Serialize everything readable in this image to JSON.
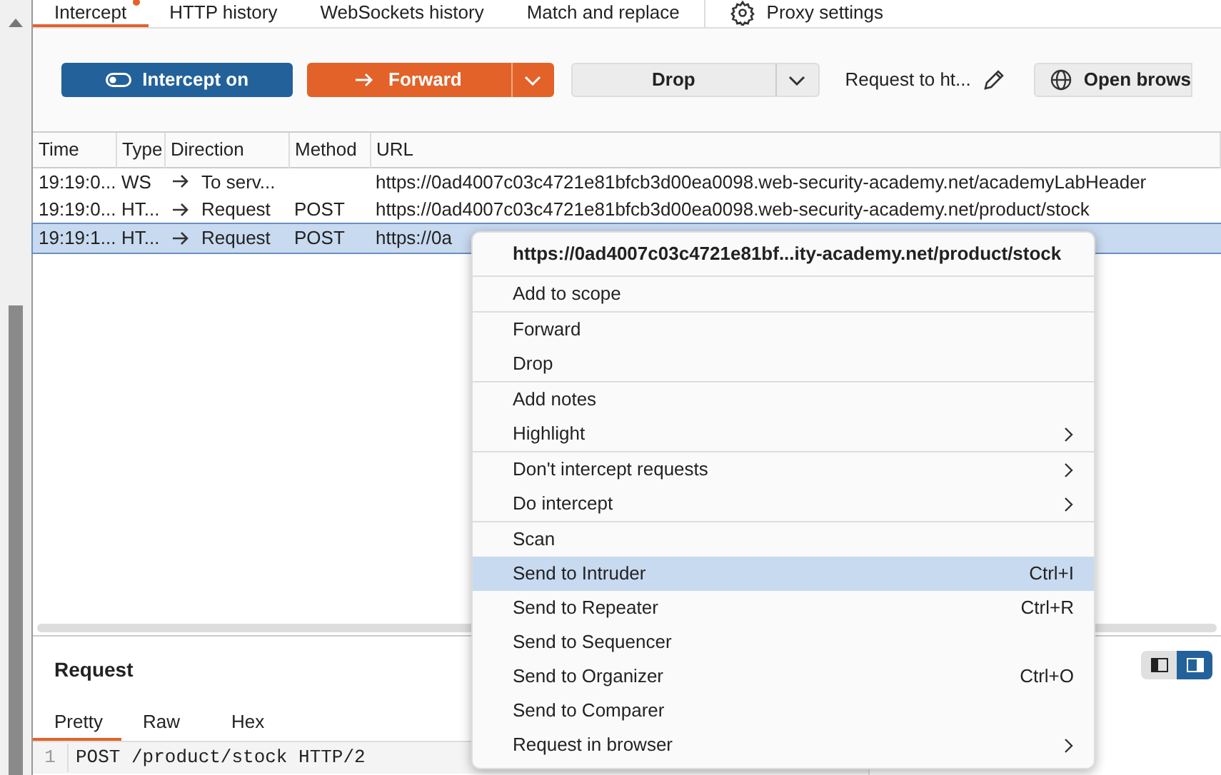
{
  "tabs": [
    {
      "label": "Intercept",
      "selected": true,
      "notification": true
    },
    {
      "label": "HTTP history",
      "selected": false,
      "notification": false
    },
    {
      "label": "WebSockets history",
      "selected": false,
      "notification": false
    },
    {
      "label": "Match and replace",
      "selected": false,
      "notification": false
    }
  ],
  "settings_tab": {
    "label": "Proxy settings"
  },
  "toolbar": {
    "intercept_button": {
      "label": "Intercept on",
      "on": true
    },
    "forward_button": {
      "label": "Forward"
    },
    "drop_button": {
      "label": "Drop"
    },
    "request_label": "Request to ht...",
    "open_browser_button": {
      "label": "Open brows"
    }
  },
  "table": {
    "columns": [
      "Time",
      "Type",
      "Direction",
      "Method",
      "URL"
    ],
    "rows": [
      {
        "time": "19:19:0...",
        "type": "WS",
        "direction": "To serv...",
        "url": "https://0ad4007c03c4721e81bfcb3d00ea0098.web-security-academy.net/academyLabHeader",
        "selected": false
      },
      {
        "time": "19:19:0...",
        "type": "HT...",
        "direction": "Request",
        "method": "POST",
        "url": "https://0ad4007c03c4721e81bfcb3d00ea0098.web-security-academy.net/product/stock",
        "selected": false
      },
      {
        "time": "19:19:1...",
        "type": "HT...",
        "direction": "Request",
        "method": "POST",
        "url": "https://0a",
        "selected": true
      }
    ]
  },
  "request_panel": {
    "title": "Request",
    "tabs": [
      {
        "label": "Pretty",
        "selected": true
      },
      {
        "label": "Raw",
        "selected": false
      },
      {
        "label": "Hex",
        "selected": false
      }
    ],
    "lines": [
      {
        "number": "1",
        "text": "POST /product/stock HTTP/2"
      }
    ],
    "layout_toggle": [
      {
        "selected": false
      },
      {
        "selected": true
      }
    ]
  },
  "context_menu": {
    "title": "https://0ad4007c03c4721e81bf...ity-academy.net/product/stock",
    "groups": [
      [
        {
          "label": "Add to scope",
          "submenu": false,
          "selected": false
        }
      ],
      [
        {
          "label": "Forward",
          "submenu": false,
          "selected": false
        },
        {
          "label": "Drop",
          "submenu": false,
          "selected": false
        }
      ],
      [
        {
          "label": "Add notes",
          "submenu": false,
          "selected": false
        },
        {
          "label": "Highlight",
          "submenu": true,
          "selected": false
        }
      ],
      [
        {
          "label": "Don't intercept requests",
          "submenu": true,
          "selected": false
        },
        {
          "label": "Do intercept",
          "submenu": true,
          "selected": false
        }
      ],
      [
        {
          "label": "Scan",
          "submenu": false,
          "selected": false
        },
        {
          "label": "Send to Intruder",
          "shortcut": "Ctrl+I",
          "submenu": false,
          "selected": true
        },
        {
          "label": "Send to Repeater",
          "shortcut": "Ctrl+R",
          "submenu": false,
          "selected": false
        },
        {
          "label": "Send to Sequencer",
          "submenu": false,
          "selected": false
        },
        {
          "label": "Send to Organizer",
          "shortcut": "Ctrl+O",
          "submenu": false,
          "selected": false
        },
        {
          "label": "Send to Comparer",
          "submenu": false,
          "selected": false
        },
        {
          "label": "Request in browser",
          "submenu": true,
          "selected": false
        }
      ]
    ]
  }
}
